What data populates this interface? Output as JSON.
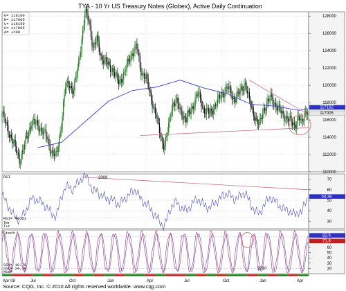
{
  "title": "TYA - 10 Yr US Treasury Notes (Globex), Active Daily Continuation",
  "source": "Source: CQG, Inc. © 2010 All rights reserved worldwide. www.cqg.com",
  "colors": {
    "price_up": "#1a7a1a",
    "price_down": "#111111",
    "ma": "#3a3ad0",
    "trend": "#c07090",
    "circle": "#e07070",
    "rsi": "#4848c0",
    "stoch_k": "#c02070",
    "stoch_d": "#5050b0",
    "bad_price": "#3030c0",
    "bad_rsi": "#3030c0",
    "bad_stoch_k": "#c02020",
    "bad_stoch_d": "#3030c0"
  },
  "chart_data": [
    {
      "type": "candlestick",
      "name": "price",
      "legend": [
        "O=  116160",
        "H=  117065",
        "L=  116150",
        "C=  117005",
        "Δ=  +200"
      ],
      "y_ticks": [
        "128000",
        "126000",
        "124000",
        "122000",
        "120000",
        "118000",
        "116000",
        "114000",
        "112000",
        "110000"
      ],
      "ylim": [
        110000,
        128500
      ],
      "current_value_badges": [
        "117152",
        "117005"
      ],
      "x_labels": [
        "Apr 08",
        "Jul",
        "Oct",
        "Jan",
        "Apr",
        "Jul",
        "Oct",
        "Jan",
        "Apr"
      ],
      "year_label": "2009",
      "year_label_2": "2010",
      "path": [
        [
          0,
          116800
        ],
        [
          6,
          114800
        ],
        [
          12,
          113200
        ],
        [
          18,
          111300
        ],
        [
          24,
          113600
        ],
        [
          30,
          115800
        ],
        [
          36,
          115400
        ],
        [
          44,
          114300
        ],
        [
          50,
          112300
        ],
        [
          55,
          111800
        ],
        [
          60,
          115600
        ],
        [
          64,
          119800
        ],
        [
          68,
          120200
        ],
        [
          72,
          119300
        ],
        [
          76,
          121500
        ],
        [
          80,
          124800
        ],
        [
          84,
          128400
        ],
        [
          88,
          127500
        ],
        [
          92,
          124300
        ],
        [
          96,
          125300
        ],
        [
          100,
          123300
        ],
        [
          106,
          122500
        ],
        [
          112,
          121800
        ],
        [
          118,
          120300
        ],
        [
          124,
          121500
        ],
        [
          130,
          123400
        ],
        [
          136,
          124600
        ],
        [
          140,
          121800
        ],
        [
          146,
          120700
        ],
        [
          150,
          118800
        ],
        [
          155,
          116800
        ],
        [
          160,
          114300
        ],
        [
          164,
          112900
        ],
        [
          168,
          114900
        ],
        [
          172,
          117800
        ],
        [
          176,
          118200
        ],
        [
          180,
          117100
        ],
        [
          186,
          116000
        ],
        [
          192,
          117400
        ],
        [
          198,
          119100
        ],
        [
          204,
          117200
        ],
        [
          210,
          116700
        ],
        [
          216,
          117800
        ],
        [
          222,
          118900
        ],
        [
          228,
          119800
        ],
        [
          234,
          118400
        ],
        [
          240,
          119100
        ],
        [
          246,
          120300
        ],
        [
          250,
          118100
        ],
        [
          256,
          116300
        ],
        [
          260,
          115300
        ],
        [
          264,
          117100
        ],
        [
          268,
          117900
        ],
        [
          272,
          118600
        ],
        [
          278,
          117500
        ],
        [
          284,
          116600
        ],
        [
          290,
          116000
        ],
        [
          296,
          115400
        ],
        [
          300,
          116300
        ],
        [
          303,
          115500
        ],
        [
          306,
          116900
        ],
        [
          309,
          117100
        ]
      ],
      "moving_average": [
        [
          36,
          112800
        ],
        [
          60,
          113400
        ],
        [
          84,
          115800
        ],
        [
          108,
          118200
        ],
        [
          132,
          119400
        ],
        [
          156,
          119800
        ],
        [
          180,
          120600
        ],
        [
          204,
          119700
        ],
        [
          228,
          119000
        ],
        [
          252,
          117800
        ],
        [
          276,
          117600
        ],
        [
          300,
          117100
        ],
        [
          309,
          117300
        ]
      ],
      "trendlines": [
        {
          "from": [
            250,
            120600
          ],
          "to": [
            310,
            116600
          ]
        },
        {
          "from": [
            140,
            114200
          ],
          "to": [
            310,
            115100
          ]
        }
      ],
      "highlight_circle": {
        "x": 301,
        "y": 115400
      }
    },
    {
      "type": "line",
      "name": "RSI",
      "label": "RSI",
      "value_label": "RSI=   40.51",
      "legend": [
        "Tmr",
        "T+r"
      ],
      "y_ticks": [
        "70",
        "60",
        "50",
        "40",
        "30"
      ],
      "ylim": [
        23,
        75
      ],
      "current_value_badge": "53.38",
      "guide_lines": [
        50,
        40,
        33
      ],
      "path": [
        [
          0,
          55
        ],
        [
          6,
          45
        ],
        [
          12,
          35
        ],
        [
          18,
          31
        ],
        [
          24,
          40
        ],
        [
          30,
          52
        ],
        [
          36,
          50
        ],
        [
          44,
          45
        ],
        [
          50,
          37
        ],
        [
          55,
          35
        ],
        [
          60,
          53
        ],
        [
          64,
          63
        ],
        [
          68,
          62
        ],
        [
          72,
          60
        ],
        [
          76,
          66
        ],
        [
          80,
          70
        ],
        [
          84,
          73
        ],
        [
          88,
          69
        ],
        [
          92,
          57
        ],
        [
          96,
          60
        ],
        [
          100,
          54
        ],
        [
          106,
          52
        ],
        [
          112,
          50
        ],
        [
          118,
          46
        ],
        [
          124,
          51
        ],
        [
          130,
          57
        ],
        [
          136,
          60
        ],
        [
          140,
          50
        ],
        [
          146,
          47
        ],
        [
          150,
          41
        ],
        [
          155,
          36
        ],
        [
          160,
          28
        ],
        [
          164,
          26
        ],
        [
          168,
          35
        ],
        [
          172,
          46
        ],
        [
          176,
          48
        ],
        [
          180,
          44
        ],
        [
          186,
          40
        ],
        [
          192,
          46
        ],
        [
          198,
          52
        ],
        [
          204,
          45
        ],
        [
          210,
          43
        ],
        [
          216,
          48
        ],
        [
          222,
          53
        ],
        [
          228,
          57
        ],
        [
          234,
          51
        ],
        [
          240,
          53
        ],
        [
          246,
          58
        ],
        [
          250,
          48
        ],
        [
          256,
          40
        ],
        [
          260,
          36
        ],
        [
          264,
          45
        ],
        [
          268,
          49
        ],
        [
          272,
          53
        ],
        [
          278,
          47
        ],
        [
          284,
          42
        ],
        [
          290,
          40
        ],
        [
          296,
          36
        ],
        [
          300,
          40
        ],
        [
          303,
          37
        ],
        [
          306,
          47
        ],
        [
          309,
          53
        ]
      ],
      "trendline": {
        "from": [
          80,
          72
        ],
        "to": [
          310,
          60
        ]
      }
    },
    {
      "type": "line",
      "name": "Stochastic",
      "label": "Stoch",
      "legend": [
        "SSK=     19.70",
        "SSD=     24.30",
        "Mid="
      ],
      "y_ticks": [
        "80",
        "70",
        "60",
        "50",
        "40",
        "30",
        "20"
      ],
      "ylim": [
        10,
        93
      ],
      "current_value_badges": [
        "82.5",
        "71.8"
      ],
      "guide_lines": [
        80,
        20
      ],
      "cycles": [
        [
          0,
          10
        ],
        [
          8,
          4
        ],
        [
          14,
          7
        ],
        [
          8,
          3
        ],
        [
          10,
          5
        ],
        [
          14,
          4
        ],
        [
          8,
          3
        ],
        [
          12,
          6
        ],
        [
          16,
          5
        ],
        [
          10,
          4
        ],
        [
          14,
          7
        ],
        [
          8,
          3
        ],
        [
          12,
          5
        ],
        [
          10,
          4
        ],
        [
          14,
          6
        ],
        [
          8,
          3
        ],
        [
          12,
          4
        ],
        [
          10,
          5
        ],
        [
          14,
          6
        ],
        [
          8,
          3
        ],
        [
          10,
          5
        ]
      ],
      "highlight_circle": {
        "x": 248,
        "y": 74
      }
    }
  ]
}
